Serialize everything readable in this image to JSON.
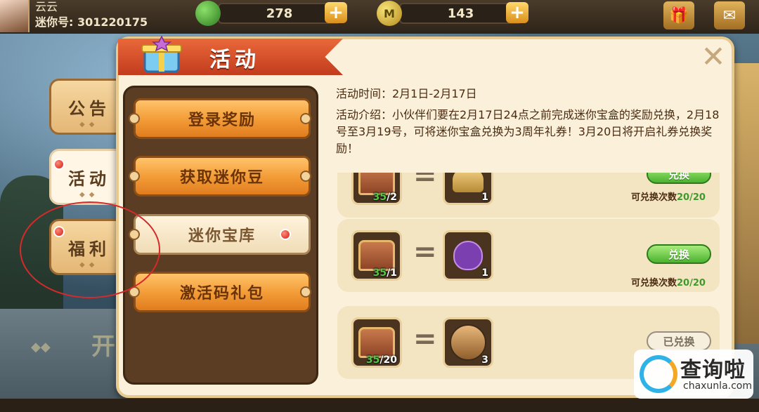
{
  "topbar": {
    "player_name": "云云",
    "player_id": "迷你号: 301220175",
    "currency_green": "278",
    "currency_gold": "143",
    "currency_gold_icon_letter": "M",
    "plus_label": "+"
  },
  "categories": [
    {
      "label": "公告",
      "active": false
    },
    {
      "label": "活动",
      "active": true
    },
    {
      "label": "福利",
      "active": false
    }
  ],
  "panel": {
    "title": "活动",
    "close_icon": "✕",
    "menu": [
      {
        "label": "登录奖励",
        "selected": false
      },
      {
        "label": "获取迷你豆",
        "selected": false
      },
      {
        "label": "迷你宝库",
        "selected": true
      },
      {
        "label": "激活码礼包",
        "selected": false
      }
    ],
    "activity_time": "活动时间：2月1日-2月17日",
    "activity_intro": "活动介绍：小伙伴们要在2月17日24点之前完成迷你宝盒的奖励兑换，2月18号至3月19号，可将迷你宝盒兑换为3周年礼券！3月20日将开启礼券兑换奖励！",
    "rows": [
      {
        "cost_have": "35",
        "cost_need": "/2",
        "reward_count": "1",
        "button": "兑换",
        "button_state": "available",
        "limit_label": "可兑换次数",
        "limit_value": "20/20"
      },
      {
        "cost_have": "35",
        "cost_need": "/1",
        "reward_count": "1",
        "button": "兑换",
        "button_state": "available",
        "limit_label": "可兑换次数",
        "limit_value": "20/20"
      },
      {
        "cost_have": "35",
        "cost_need": "/20",
        "reward_count": "3",
        "button": "已兑换",
        "button_state": "done",
        "limit_label": "",
        "limit_value": ""
      }
    ],
    "equals": "="
  },
  "background": {
    "partial_text": "开"
  },
  "watermark": {
    "cn": "查询啦",
    "en": "chaxunla.com"
  },
  "colors": {
    "accent_orange": "#f29a35",
    "ribbon_red": "#d14a25",
    "exchange_green": "#4bb22e",
    "panel_cream": "#fbf1db"
  }
}
